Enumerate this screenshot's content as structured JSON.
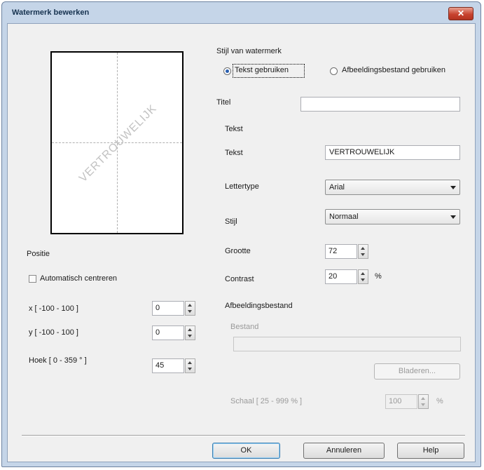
{
  "window": {
    "title": "Watermerk bewerken",
    "close_glyph": "✕"
  },
  "preview": {
    "watermark_text": "VERTROUWELIJK",
    "angle_deg": 45
  },
  "position": {
    "heading": "Positie",
    "auto_center_label": "Automatisch centreren",
    "auto_center_checked": false,
    "x_label": "x [ -100 - 100 ]",
    "x_value": "0",
    "y_label": "y [ -100 - 100 ]",
    "y_value": "0",
    "angle_label": "Hoek [ 0 - 359 ° ]",
    "angle_value": "45"
  },
  "style": {
    "heading": "Stijl van watermerk",
    "text_radio_label": "Tekst gebruiken",
    "image_radio_label": "Afbeeldingsbestand gebruiken",
    "selected": "text"
  },
  "title_field": {
    "label": "Titel",
    "value": ""
  },
  "text_group": {
    "heading": "Tekst",
    "text_label": "Tekst",
    "text_value": "VERTROUWELIJK",
    "font_label": "Lettertype",
    "font_value": "Arial",
    "style_label": "Stijl",
    "style_value": "Normaal",
    "size_label": "Grootte",
    "size_value": "72",
    "contrast_label": "Contrast",
    "contrast_value": "20",
    "contrast_unit": "%"
  },
  "image_group": {
    "heading": "Afbeeldingsbestand",
    "file_label": "Bestand",
    "file_value": "",
    "browse_label": "Bladeren...",
    "scale_label": "Schaal [ 25 - 999 % ]",
    "scale_value": "100",
    "scale_unit": "%"
  },
  "buttons": {
    "ok": "OK",
    "cancel": "Annuleren",
    "help": "Help"
  },
  "colors": {
    "titlebar": "#c5d5e8",
    "close": "#c8432e",
    "radio_selected": "#2a5fb0",
    "default_button": "#3c7fb1"
  }
}
